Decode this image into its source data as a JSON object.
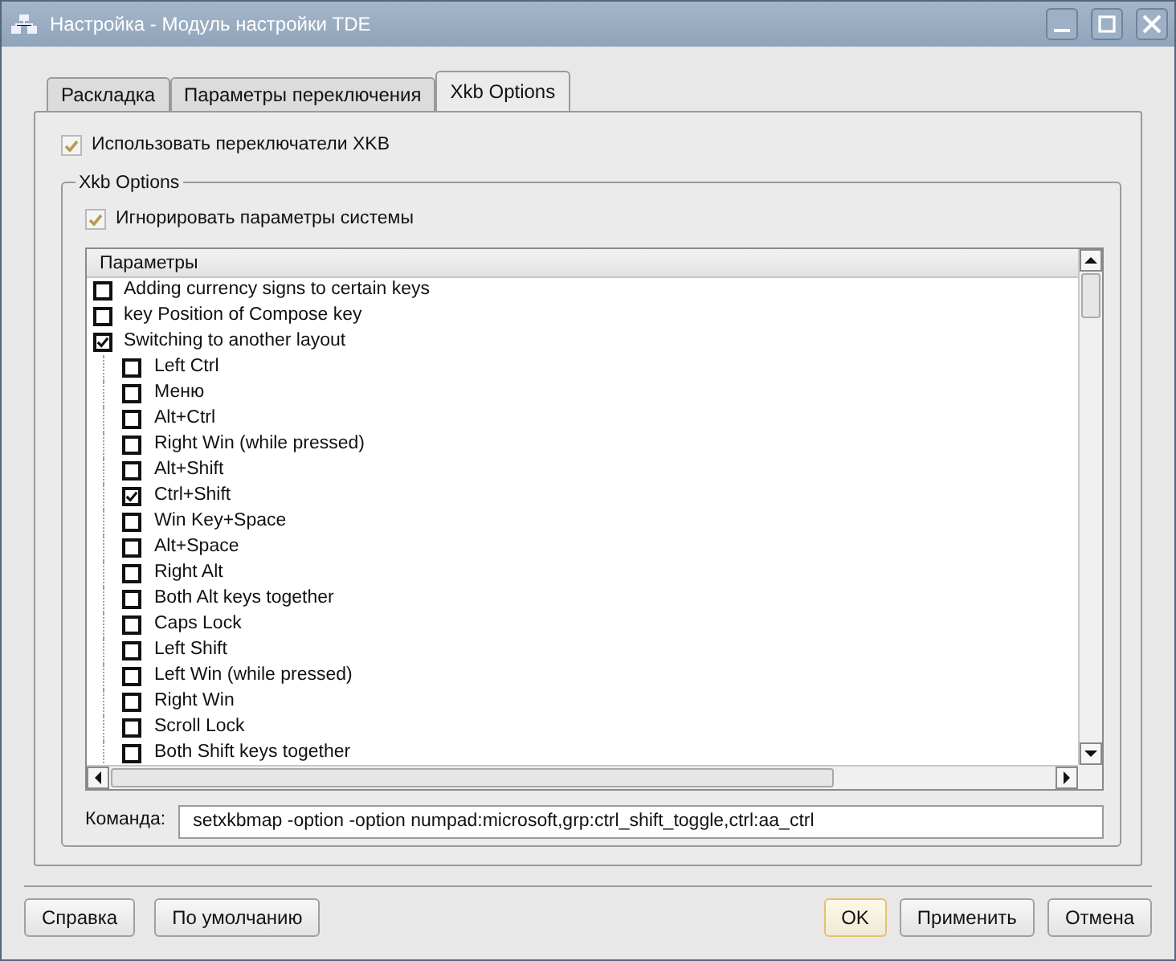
{
  "window": {
    "title": "Настройка - Модуль настройки TDE"
  },
  "tabs": [
    {
      "label": "Раскладка",
      "selected": false
    },
    {
      "label": "Параметры переключения",
      "selected": false
    },
    {
      "label": "Xkb Options",
      "selected": true
    }
  ],
  "use_xkb": {
    "label": "Использовать переключатели XKB",
    "checked": true
  },
  "group": {
    "title": "Xkb Options",
    "ignore": {
      "label": "Игнорировать параметры системы",
      "checked": true
    },
    "list": {
      "column": "Параметры",
      "items": [
        {
          "label": "Adding currency signs to certain keys",
          "checked": false
        },
        {
          "label": "key Position of Compose key",
          "checked": false
        },
        {
          "label": "Switching to another layout",
          "checked": true,
          "children": [
            {
              "label": "Left Ctrl",
              "checked": false
            },
            {
              "label": "Меню",
              "checked": false
            },
            {
              "label": "Alt+Ctrl",
              "checked": false
            },
            {
              "label": "Right Win (while pressed)",
              "checked": false
            },
            {
              "label": "Alt+Shift",
              "checked": false
            },
            {
              "label": "Ctrl+Shift",
              "checked": true
            },
            {
              "label": "Win Key+Space",
              "checked": false
            },
            {
              "label": "Alt+Space",
              "checked": false
            },
            {
              "label": "Right Alt",
              "checked": false
            },
            {
              "label": "Both Alt keys together",
              "checked": false
            },
            {
              "label": "Caps Lock",
              "checked": false
            },
            {
              "label": "Left Shift",
              "checked": false
            },
            {
              "label": "Left Win (while pressed)",
              "checked": false
            },
            {
              "label": "Right Win",
              "checked": false
            },
            {
              "label": "Scroll Lock",
              "checked": false
            },
            {
              "label": "Both Shift keys together",
              "checked": false
            }
          ]
        }
      ]
    },
    "command": {
      "label": "Команда:",
      "value": "setxkbmap -option -option numpad:microsoft,grp:ctrl_shift_toggle,ctrl:aa_ctrl"
    }
  },
  "buttons_left": [
    {
      "label": "Справка",
      "default": false
    },
    {
      "label": "По умолчанию",
      "default": false
    }
  ],
  "buttons_right": [
    {
      "label": "OK",
      "default": true
    },
    {
      "label": "Применить",
      "default": false
    },
    {
      "label": "Отмена",
      "default": false
    }
  ]
}
